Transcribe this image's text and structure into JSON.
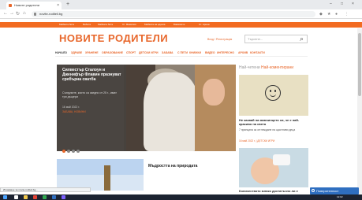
{
  "browser": {
    "tab_title": "Новите родители",
    "tab_close": "×",
    "new_tab": "+",
    "url": "novite-roditeli.bg",
    "nav": {
      "back": "←",
      "forward": "→",
      "reload": "↻",
      "home": "⌂"
    },
    "window": {
      "minimize": "–",
      "maximize": "□",
      "close": "×"
    }
  },
  "top_strip": {
    "items": [
      "Майката бита",
      "Бебета",
      "Майката бита",
      "Ст. Фамилия",
      "Майката на едната",
      "Бавачките",
      "Ст. Арена"
    ]
  },
  "site": {
    "logo": "НОВИТЕ РОДИТЕЛИ",
    "user_links": "Вход / Регистрация",
    "search_placeholder": "Търсене...",
    "search_icon": "search-icon",
    "menu": [
      "НАЧАЛО",
      "ЗДРАВЕ",
      "ХРАНЕНЕ",
      "ОБРАЗОВАНИЕ",
      "СПОРТ",
      "ДЕТСКИ ИГРИ",
      "ЗАБАВА",
      "С ПЕТИ",
      "КНИЖКИ",
      "ВИДЕО",
      "ИНТЕРЕСНО",
      "АРХИВ",
      "КОНТАКТИ"
    ]
  },
  "hero": {
    "title": "Силвестър Сталоун и Дженифър Флавин празнуват сребърна сватба",
    "text": "Съпрузите, които са заедно от 25 г., имат три дъщери",
    "date": "16 май 2022 г.",
    "tag": "ЗАБАВА, НОВИНИ",
    "slides": 4,
    "active_slide": 1
  },
  "sidebar": {
    "heading_muted": "Най-четени",
    "heading": "Най-коментирани",
    "article1": {
      "title": "Не казвай на мамчинцето си, че е най-красиво на света",
      "summary": "7 принципа за отглеждане на щастливи деца",
      "date": "16 май 2022 г. | ДЕТСКИ ИГРИ"
    },
    "article2": {
      "title": "Количеството мляко достатъчно ли е"
    }
  },
  "bottom_article": {
    "title": "Мъдростта на природата"
  },
  "status_text": "Изчакване за novite-roditeli.bg...",
  "popup": "Поверителност",
  "clock": "12:02",
  "colors": {
    "accent": "#e8672b",
    "top_strip": "#f26b21",
    "taskbar": "#1c2331"
  }
}
